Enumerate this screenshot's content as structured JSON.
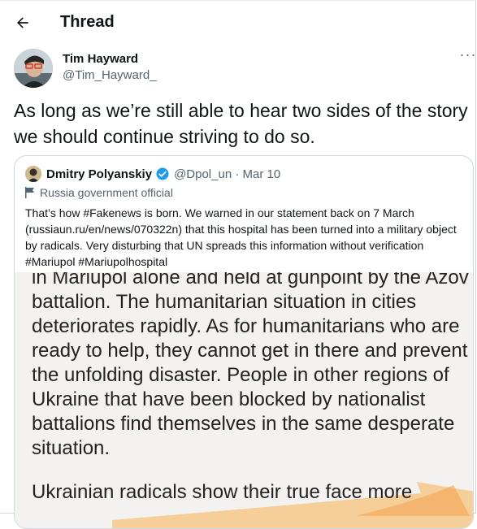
{
  "header": {
    "title": "Thread"
  },
  "author": {
    "name": "Tim Hayward",
    "handle": "@Tim_Hayward_"
  },
  "tweet": {
    "text": "As long as we’re still able to hear two sides of the story we should continue striving to do so."
  },
  "more_label": "···",
  "quote": {
    "name": "Dmitry Polyanskiy",
    "handle": "@Dpol_un",
    "separator": " · ",
    "date": "Mar 10",
    "label": "Russia government official",
    "text": "That’s how #Fakenews is born. We warned in our statement back on 7 March (russiaun.ru/en/news/070322n) that this hospital has been turned into a military object by radicals. Very disturbing that UN spreads this information without verification #Mariupol #Mariupolhospital",
    "image_text": "in Mariupol alone and held at gunpoint by the Azov battalion. The humanitarian situation in cities deteriorates rapidly. As for humanitarians who are ready to help, they cannot get in there and prevent the unfolding disaster. People in other regions of Ukraine that have been blocked by nationalist battalions find themselves in the same desperate situation.",
    "image_text2": "Ukrainian radicals show their true face more"
  },
  "colors": {
    "verified": "#1d9bf0",
    "highlight": "#f6c17c"
  }
}
